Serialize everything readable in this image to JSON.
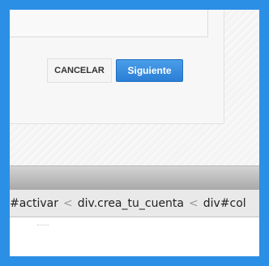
{
  "dialog": {
    "cancel_label": "CANCELAR",
    "next_label": "Siguiente"
  },
  "breadcrumb": {
    "items": [
      "#activar",
      "div.crea_tu_cuenta",
      "div#col"
    ],
    "separator": "<"
  },
  "colors": {
    "frame": "#2b8fe6",
    "primary_button": "#2a7fd6"
  }
}
